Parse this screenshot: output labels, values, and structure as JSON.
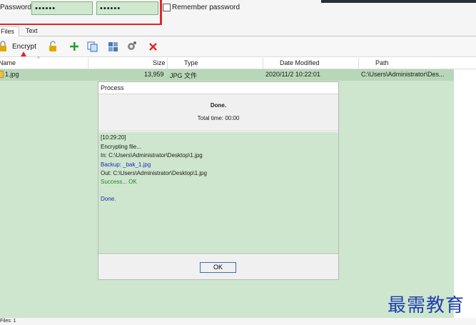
{
  "password_bar": {
    "label": "Password:",
    "password_value": "••••••",
    "confirm_value": "••••••",
    "remember_label": "Remember password"
  },
  "tabs": [
    {
      "label": "Files",
      "active": true
    },
    {
      "label": "Text",
      "active": false
    }
  ],
  "toolbar": {
    "encrypt_label": "Encrypt",
    "icons": [
      "lock-icon",
      "unlock-icon",
      "add-icon",
      "copy-icon",
      "grid-icon",
      "settings-icon",
      "delete-icon"
    ]
  },
  "file_list": {
    "columns": [
      "Name",
      "Size",
      "Type",
      "Date Modified",
      "Path"
    ],
    "rows": [
      {
        "name": "1.jpg",
        "size": "13,959",
        "type": "JPG 文件",
        "date": "2020/11/2 10:22:01",
        "path": "C:\\Users\\Administrator\\Des..."
      }
    ]
  },
  "dialog": {
    "title": "Process",
    "status": "Done.",
    "total_time": "Total time: 00:00",
    "log": [
      {
        "text": "[10:29:20]",
        "color": "default"
      },
      {
        "text": "Encrypting file...",
        "color": "default"
      },
      {
        "text": "In: C:\\Users\\Administrator\\Desktop\\1.jpg",
        "color": "default"
      },
      {
        "text": "Backup: _bak_1.jpg",
        "color": "blue"
      },
      {
        "text": "Out: C:\\Users\\Administrator\\Desktop\\1.jpg",
        "color": "default"
      },
      {
        "text": "Success... OK",
        "color": "green"
      },
      {
        "text": "Done.",
        "color": "blue"
      }
    ],
    "ok_label": "OK"
  },
  "statusbar": {
    "text": "Files: 1"
  },
  "watermark": {
    "text": "最需教育"
  },
  "colors": {
    "accent_red": "#e0262b",
    "list_background": "#cde6cd",
    "selected_row": "#b8d6b8",
    "watermark": "#1f3fb0"
  }
}
